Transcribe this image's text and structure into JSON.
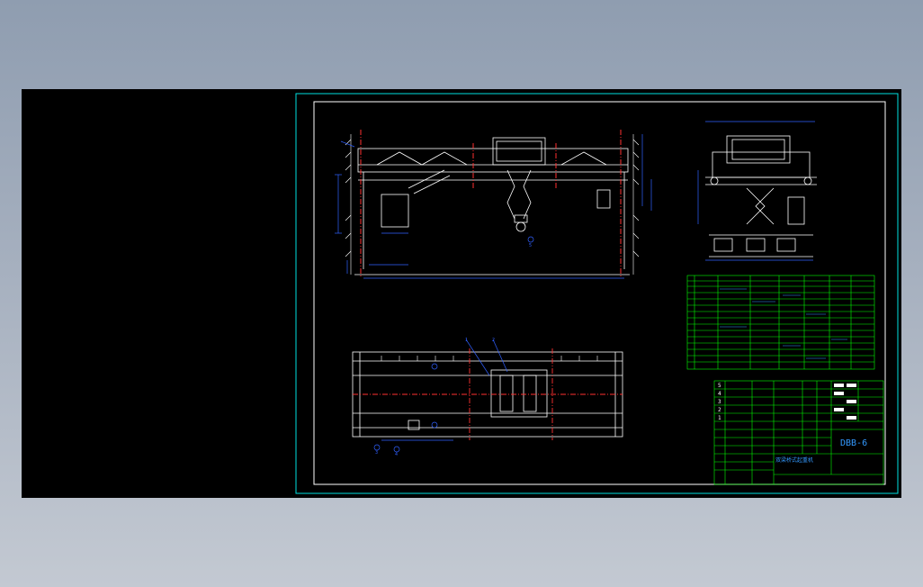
{
  "drawing": {
    "colors": {
      "background": "#000000",
      "sheet_border": "#00e0e0",
      "frame": "#ffffff",
      "structure": "#ffffff",
      "dimension": "#3060ff",
      "centerline": "#ff3030",
      "table": "#00ff00",
      "title_text": "#3399ff"
    },
    "title_block": {
      "drawing_number": "DBB-6",
      "description": "双梁桥式起重机",
      "rev_rows": [
        "5",
        "4",
        "3",
        "2",
        "1"
      ]
    },
    "balloons": [
      "1",
      "2",
      "3",
      "4",
      "5"
    ],
    "views": [
      "front-elevation",
      "side-elevation",
      "plan-view",
      "parts-list",
      "title-block"
    ]
  }
}
